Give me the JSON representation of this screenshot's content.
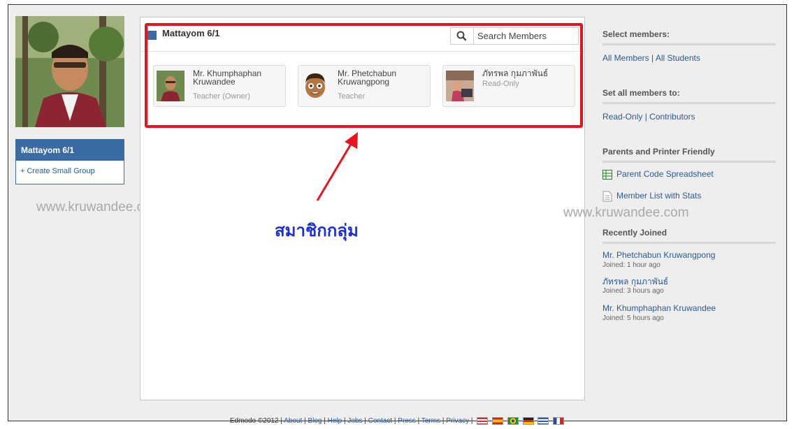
{
  "group": {
    "title": "Mattayom 6/1",
    "create_small_group": "+ Create Small Group"
  },
  "watermarks": {
    "left": "www.kruwandee.com",
    "right": "www.kruwandee.com"
  },
  "search": {
    "placeholder": "Search Members"
  },
  "members": [
    {
      "name": "Mr. Khumphaphan Kruwandee",
      "role": "Teacher (Owner)"
    },
    {
      "name": "Mr. Phetchabun Kruwangpong",
      "role": "Teacher"
    },
    {
      "name": "ภัทรพล กุมภาพันธ์",
      "role": "Read-Only"
    }
  ],
  "annotation": "สมาชิกกลุ่ม",
  "sidebar": {
    "select_members": {
      "heading": "Select members:",
      "all_members": "All Members",
      "separator": " | ",
      "all_students": "All Students"
    },
    "set_members": {
      "heading": "Set all members to:",
      "read_only": "Read-Only",
      "separator": " | ",
      "contributors": "Contributors"
    },
    "parents": {
      "heading": "Parents and Printer Friendly",
      "spreadsheet": "Parent Code Spreadsheet",
      "member_list": "Member List with Stats"
    },
    "recently_joined": {
      "heading": "Recently Joined",
      "entries": [
        {
          "name": "Mr. Phetchabun Kruwangpong",
          "joined": "Joined: 1 hour ago"
        },
        {
          "name": "ภัทรพล กุมภาพันธ์",
          "joined": "Joined: 3 hours ago"
        },
        {
          "name": "Mr. Khumphaphan Kruwandee",
          "joined": "Joined: 5 hours ago"
        }
      ]
    }
  },
  "footer": {
    "copyright": "Edmodo ©2012",
    "links": [
      "About",
      "Blog",
      "Help",
      "Jobs",
      "Contact",
      "Press",
      "Terms",
      "Privacy"
    ],
    "flag_icons": [
      "us-flag-icon",
      "spain-flag-icon",
      "brazil-flag-icon",
      "germany-flag-icon",
      "greece-flag-icon",
      "france-flag-icon"
    ]
  },
  "colors": {
    "accent": "#3a6ca3",
    "link": "#2a5b94",
    "highlight": "#e8131c",
    "annotation": "#1d2fd6"
  }
}
